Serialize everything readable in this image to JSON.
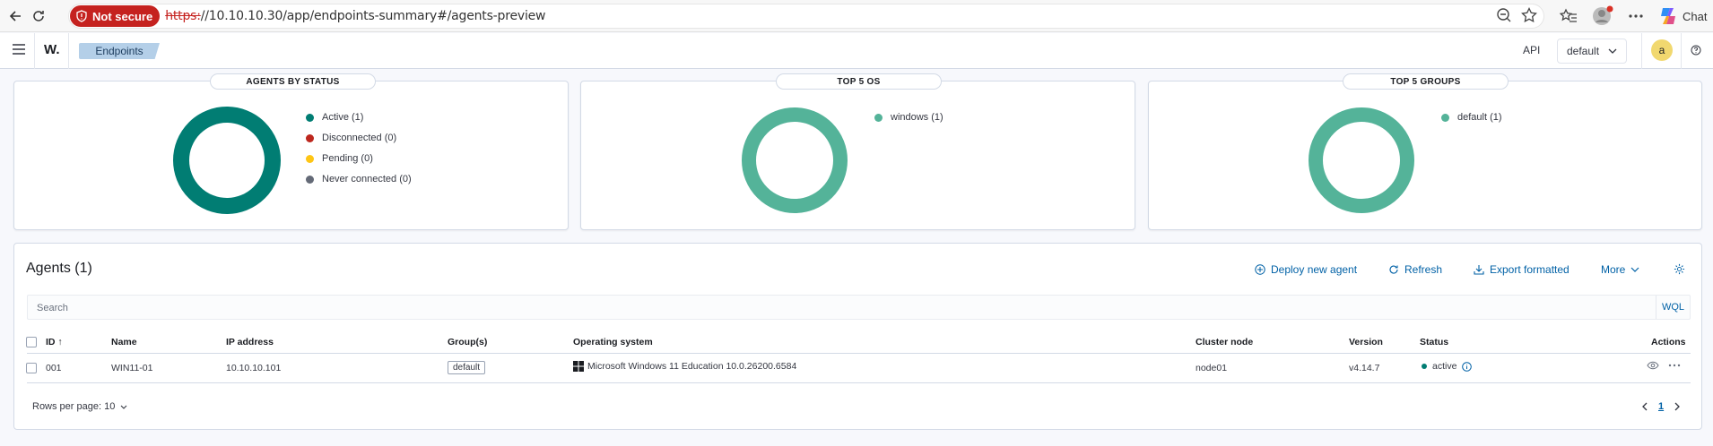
{
  "browser": {
    "not_secure_label": "Not secure",
    "url_protocol": "https:",
    "url_rest": "//10.10.10.30/app/endpoints-summary#/agents-preview",
    "chat_label": "Chat"
  },
  "header": {
    "logo": "W.",
    "breadcrumb": "Endpoints",
    "api_label": "API",
    "space": "default",
    "avatar_initial": "a"
  },
  "panels": [
    {
      "title": "AGENTS BY STATUS",
      "ring_color": "#017d73",
      "legend": [
        {
          "label": "Active (1)",
          "color": "#017d73"
        },
        {
          "label": "Disconnected (0)",
          "color": "#bd271e"
        },
        {
          "label": "Pending (0)",
          "color": "#fec514"
        },
        {
          "label": "Never connected (0)",
          "color": "#646a77"
        }
      ]
    },
    {
      "title": "TOP 5 OS",
      "ring_color": "#54b399",
      "legend": [
        {
          "label": "windows (1)",
          "color": "#54b399"
        }
      ]
    },
    {
      "title": "TOP 5 GROUPS",
      "ring_color": "#54b399",
      "legend": [
        {
          "label": "default (1)",
          "color": "#54b399"
        }
      ]
    }
  ],
  "agents": {
    "title": "Agents (1)",
    "actions": {
      "deploy": "Deploy new agent",
      "refresh": "Refresh",
      "export": "Export formatted",
      "more": "More"
    },
    "search_placeholder": "Search",
    "wql_label": "WQL",
    "columns": {
      "id": "ID",
      "name": "Name",
      "ip": "IP address",
      "groups": "Group(s)",
      "os": "Operating system",
      "cluster": "Cluster node",
      "version": "Version",
      "status": "Status",
      "actions": "Actions"
    },
    "rows": [
      {
        "id": "001",
        "name": "WIN11-01",
        "ip": "10.10.10.101",
        "group": "default",
        "os": "Microsoft Windows 11 Education 10.0.26200.6584",
        "cluster": "node01",
        "version": "v4.14.7",
        "status": "active",
        "status_color": "#017d73"
      }
    ],
    "rows_per_page": "Rows per page: 10",
    "current_page": "1"
  }
}
